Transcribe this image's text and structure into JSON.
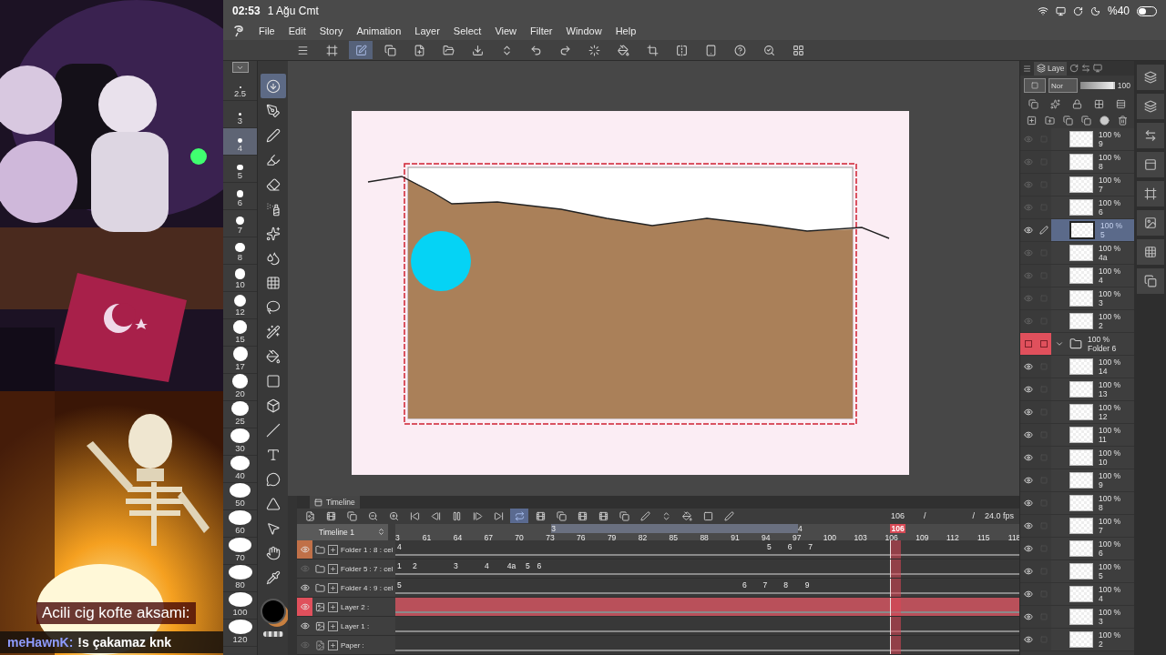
{
  "status_bar": {
    "time": "02:53",
    "date": "1 Ağu Cmt",
    "battery": "%40"
  },
  "overlay": {
    "caption": "Acili cig kofte aksami:",
    "chat_user": "meHawnK:",
    "chat_message": "!s çakamaz knk"
  },
  "menu": [
    "File",
    "Edit",
    "Story",
    "Animation",
    "Layer",
    "Select",
    "View",
    "Filter",
    "Window",
    "Help"
  ],
  "toolbar": [
    {
      "kind": "menu",
      "selected": false
    },
    {
      "kind": "frame",
      "selected": false
    },
    {
      "kind": "edit",
      "selected": true
    },
    {
      "kind": "copy",
      "selected": false
    },
    {
      "kind": "new-file",
      "selected": false
    },
    {
      "kind": "folder",
      "selected": false
    },
    {
      "kind": "save",
      "selected": false
    },
    {
      "kind": "updown",
      "selected": false
    },
    {
      "kind": "undo",
      "selected": false
    },
    {
      "kind": "redo",
      "selected": false
    },
    {
      "kind": "loader",
      "selected": false
    },
    {
      "kind": "bucket",
      "selected": false
    },
    {
      "kind": "crop",
      "selected": false
    },
    {
      "kind": "flip",
      "selected": false
    },
    {
      "kind": "tablet",
      "selected": false
    },
    {
      "kind": "help",
      "selected": false
    },
    {
      "kind": "search",
      "selected": false
    },
    {
      "kind": "grid",
      "selected": false
    }
  ],
  "brush_sizes": [
    {
      "label": "2.5",
      "selected": false
    },
    {
      "label": "3",
      "selected": false
    },
    {
      "label": "4",
      "selected": true
    },
    {
      "label": "5",
      "selected": false
    },
    {
      "label": "6",
      "selected": false
    },
    {
      "label": "7",
      "selected": false
    },
    {
      "label": "8",
      "selected": false
    },
    {
      "label": "10",
      "selected": false
    },
    {
      "label": "12",
      "selected": false
    },
    {
      "label": "15",
      "selected": false
    },
    {
      "label": "17",
      "selected": false
    },
    {
      "label": "20",
      "selected": false
    },
    {
      "label": "25",
      "selected": false
    },
    {
      "label": "30",
      "selected": false
    },
    {
      "label": "40",
      "selected": false
    },
    {
      "label": "50",
      "selected": false
    },
    {
      "label": "60",
      "selected": false
    },
    {
      "label": "70",
      "selected": false
    },
    {
      "label": "80",
      "selected": false
    },
    {
      "label": "100",
      "selected": false
    },
    {
      "label": "120",
      "selected": false
    }
  ],
  "tools": [
    {
      "kind": "import",
      "selected": true
    },
    {
      "kind": "pen-nib",
      "selected": false
    },
    {
      "kind": "pen",
      "selected": false
    },
    {
      "kind": "marker",
      "selected": false
    },
    {
      "kind": "eraser",
      "selected": false
    },
    {
      "kind": "airbrush",
      "selected": false
    },
    {
      "kind": "sparkle",
      "selected": false
    },
    {
      "kind": "blend",
      "selected": false
    },
    {
      "kind": "grid",
      "selected": false
    },
    {
      "kind": "lasso",
      "selected": false
    },
    {
      "kind": "wand",
      "selected": false
    },
    {
      "kind": "fill",
      "selected": false
    },
    {
      "kind": "gradient",
      "selected": false
    },
    {
      "kind": "object",
      "selected": false
    },
    {
      "kind": "line",
      "selected": false
    },
    {
      "kind": "text",
      "selected": false
    },
    {
      "kind": "balloon",
      "selected": false
    },
    {
      "kind": "ruler",
      "selected": false
    },
    {
      "kind": "pointer",
      "selected": false
    },
    {
      "kind": "hand",
      "selected": false
    },
    {
      "kind": "eyedropper",
      "selected": false
    }
  ],
  "timeline": {
    "tab": "Timeline",
    "controls": [
      {
        "kind": "new",
        "selected": false
      },
      {
        "kind": "cel",
        "selected": false
      },
      {
        "kind": "cel-copy",
        "selected": false
      },
      {
        "kind": "zoom-out",
        "selected": false
      },
      {
        "kind": "zoom-in",
        "selected": false
      },
      {
        "kind": "first",
        "selected": false
      },
      {
        "kind": "prev",
        "selected": false
      },
      {
        "kind": "pause",
        "selected": false
      },
      {
        "kind": "next",
        "selected": false
      },
      {
        "kind": "last",
        "selected": false
      },
      {
        "kind": "loop",
        "selected": true
      },
      {
        "kind": "cel",
        "selected": false
      },
      {
        "kind": "cel-copy",
        "selected": false
      },
      {
        "kind": "cel",
        "selected": false
      },
      {
        "kind": "cel",
        "selected": false
      },
      {
        "kind": "copy",
        "selected": false
      },
      {
        "kind": "pen",
        "selected": false
      },
      {
        "kind": "updown",
        "selected": false
      },
      {
        "kind": "bucket",
        "selected": false
      },
      {
        "kind": "square",
        "selected": false
      },
      {
        "kind": "pen",
        "selected": false
      }
    ],
    "current_frame": "106",
    "divider": "/",
    "divider_2": "/",
    "fps": "24.0 fps",
    "name": "Timeline 1",
    "ruler": [
      "3",
      "61",
      "64",
      "67",
      "70",
      "73",
      "76",
      "79",
      "82",
      "85",
      "88",
      "91",
      "94",
      "97",
      "100",
      "103",
      "106",
      "109",
      "112",
      "115",
      "118"
    ],
    "sections": [
      {
        "label": "3",
        "shaded": true
      },
      {
        "label": "4",
        "shaded": false
      }
    ],
    "playhead": "106",
    "tracks": [
      {
        "name": "Folder 1 : 8 : cel",
        "kind": "folder",
        "visible": true,
        "selected": false,
        "color": "#c07048",
        "cels": [
          "4",
          "5",
          "6",
          "7"
        ]
      },
      {
        "name": "Folder 5 : 7 : cel",
        "kind": "folder",
        "visible": false,
        "selected": false,
        "cels": [
          "1",
          "2",
          "3",
          "4",
          "4a",
          "5",
          "6"
        ]
      },
      {
        "name": "Folder 4 : 9 : cel",
        "kind": "folder",
        "visible": true,
        "selected": false,
        "cels": [
          "5",
          "6",
          "7",
          "8",
          "9"
        ]
      },
      {
        "name": "Layer 2 :",
        "kind": "layer",
        "visible": true,
        "selected": true
      },
      {
        "name": "Layer 1 :",
        "kind": "layer",
        "visible": true,
        "selected": false
      },
      {
        "name": "Paper :",
        "kind": "paper",
        "visible": false,
        "selected": false
      }
    ]
  },
  "layers": {
    "tab": "Laye",
    "blend_mode": "Nor",
    "opacity_slider": {
      "level": 1
    },
    "opacity": "100",
    "rows": [
      {
        "kind": "layer",
        "opacity": "100 %",
        "name": "9",
        "visible": false,
        "selected": false
      },
      {
        "kind": "layer",
        "opacity": "100 %",
        "name": "8",
        "visible": false,
        "selected": false
      },
      {
        "kind": "layer",
        "opacity": "100 %",
        "name": "7",
        "visible": false,
        "selected": false
      },
      {
        "kind": "layer",
        "opacity": "100 %",
        "name": "6",
        "visible": false,
        "selected": false
      },
      {
        "kind": "layer",
        "opacity": "100 %",
        "name": "5",
        "visible": true,
        "selected": true
      },
      {
        "kind": "layer",
        "opacity": "100 %",
        "name": "4a",
        "visible": false,
        "selected": false
      },
      {
        "kind": "layer",
        "opacity": "100 %",
        "name": "4",
        "visible": false,
        "selected": false
      },
      {
        "kind": "layer",
        "opacity": "100 %",
        "name": "3",
        "visible": false,
        "selected": false
      },
      {
        "kind": "layer",
        "opacity": "100 %",
        "name": "2",
        "visible": false,
        "selected": false
      },
      {
        "kind": "folder",
        "opacity": "100 %",
        "name": "Folder 6",
        "selected": false,
        "expanded": true
      },
      {
        "kind": "layer",
        "opacity": "100 %",
        "name": "14",
        "visible": true,
        "selected": false
      },
      {
        "kind": "layer",
        "opacity": "100 %",
        "name": "13",
        "visible": true,
        "selected": false
      },
      {
        "kind": "layer",
        "opacity": "100 %",
        "name": "12",
        "visible": true,
        "selected": false
      },
      {
        "kind": "layer",
        "opacity": "100 %",
        "name": "11",
        "visible": true,
        "selected": false
      },
      {
        "kind": "layer",
        "opacity": "100 %",
        "name": "10",
        "visible": true,
        "selected": false
      },
      {
        "kind": "layer",
        "opacity": "100 %",
        "name": "9",
        "visible": true,
        "selected": false
      },
      {
        "kind": "layer",
        "opacity": "100 %",
        "name": "8",
        "visible": true,
        "selected": false
      },
      {
        "kind": "layer",
        "opacity": "100 %",
        "name": "7",
        "visible": true,
        "selected": false
      },
      {
        "kind": "layer",
        "opacity": "100 %",
        "name": "6",
        "visible": true,
        "selected": false
      },
      {
        "kind": "layer",
        "opacity": "100 %",
        "name": "5",
        "visible": true,
        "selected": false
      },
      {
        "kind": "layer",
        "opacity": "100 %",
        "name": "4",
        "visible": true,
        "selected": false
      },
      {
        "kind": "layer",
        "opacity": "100 %",
        "name": "3",
        "visible": true,
        "selected": false
      },
      {
        "kind": "layer",
        "opacity": "100 %",
        "name": "2",
        "visible": true,
        "selected": false
      }
    ]
  }
}
